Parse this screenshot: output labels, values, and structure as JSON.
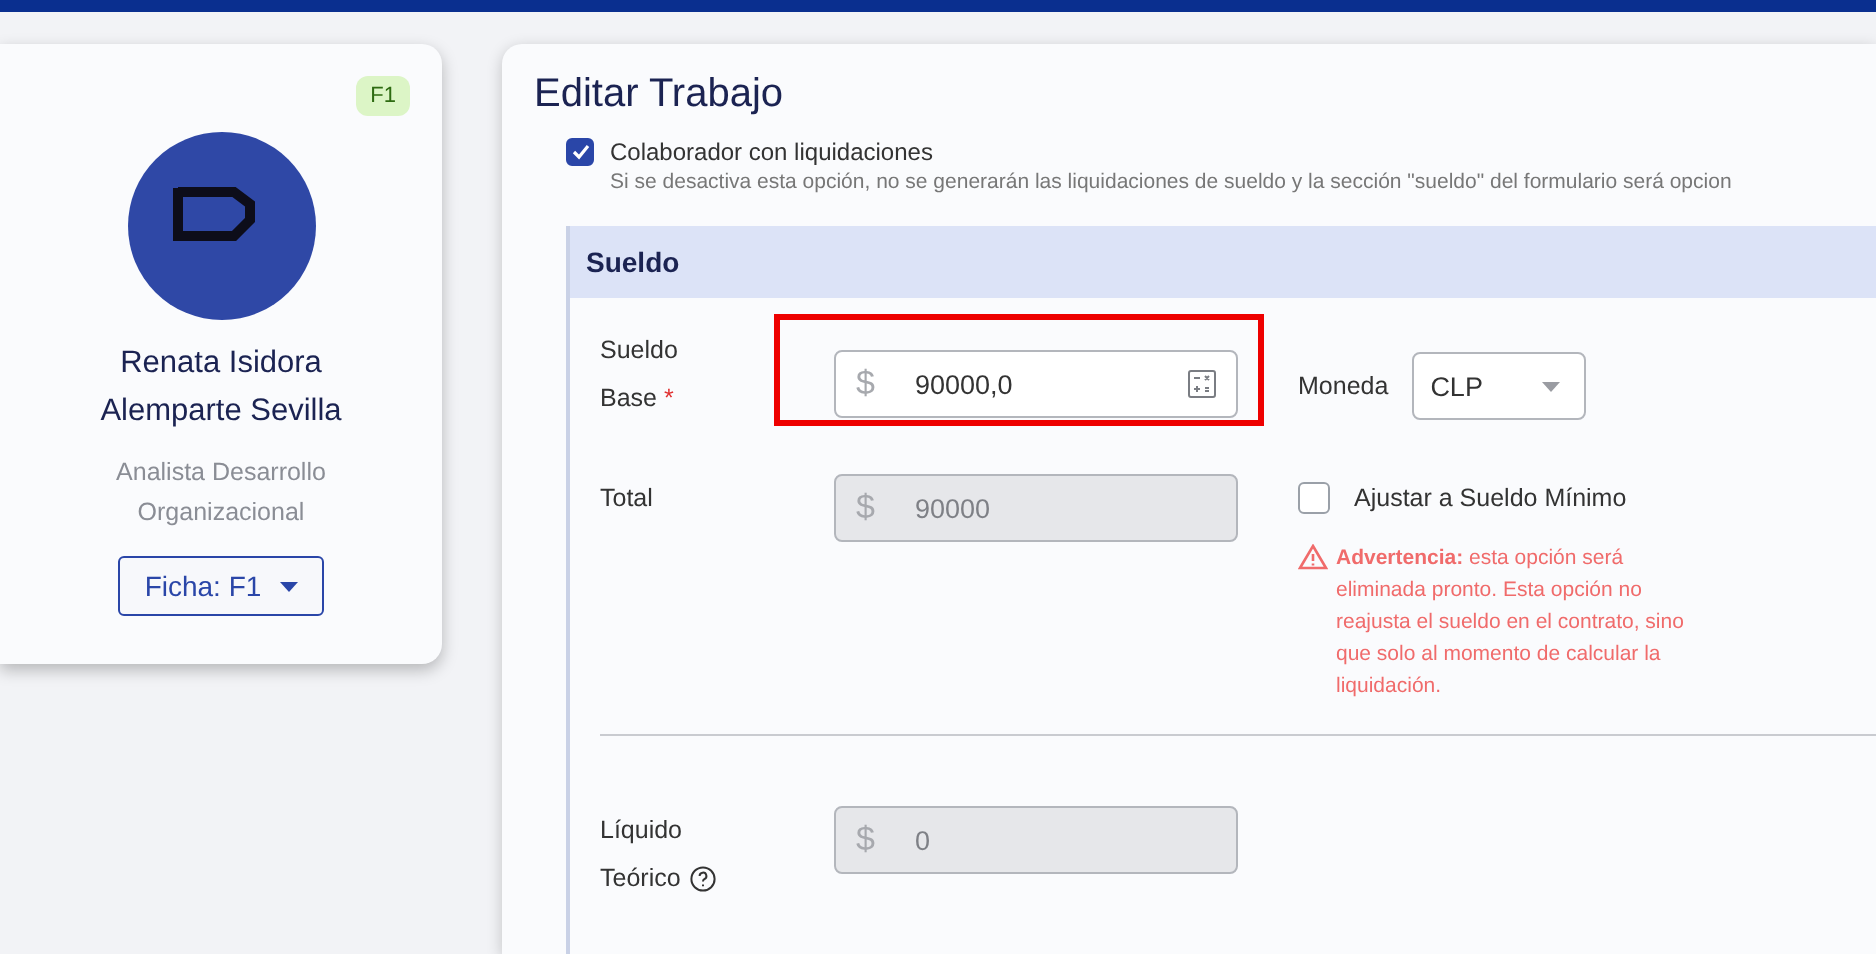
{
  "profile": {
    "badge": "F1",
    "name": "Renata Isidora Alemparte Sevilla",
    "role": "Analista Desarrollo Organizacional",
    "ficha_button": "Ficha: F1"
  },
  "editor": {
    "title": "Editar Trabajo",
    "option": {
      "label": "Colaborador con liquidaciones",
      "checked": true,
      "hint": "Si se desactiva esta opción, no se generarán las liquidaciones de sueldo y la sección \"sueldo\" del formulario será opcion"
    },
    "section": {
      "title": "Sueldo",
      "base": {
        "label": "Sueldo",
        "label_2": "Base",
        "required": "*",
        "prefix": "$",
        "value": "90000,0",
        "highlighted": true
      },
      "currency": {
        "label": "Moneda",
        "value": "CLP"
      },
      "total": {
        "label": "Total",
        "prefix": "$",
        "value": "90000",
        "disabled": true
      },
      "minimum": {
        "label": "Ajustar a Sueldo Mínimo",
        "checked": false
      },
      "warning": "**Advertencia:** esta opción será eliminada pronto. Esta opción no reajusta el sueldo en el contrato, sino que solo al momento de calcular la liquidación.",
      "net": {
        "label": "Líquido",
        "label_2": "Teórico",
        "prefix": "$",
        "value": "0",
        "disabled": true
      }
    }
  }
}
